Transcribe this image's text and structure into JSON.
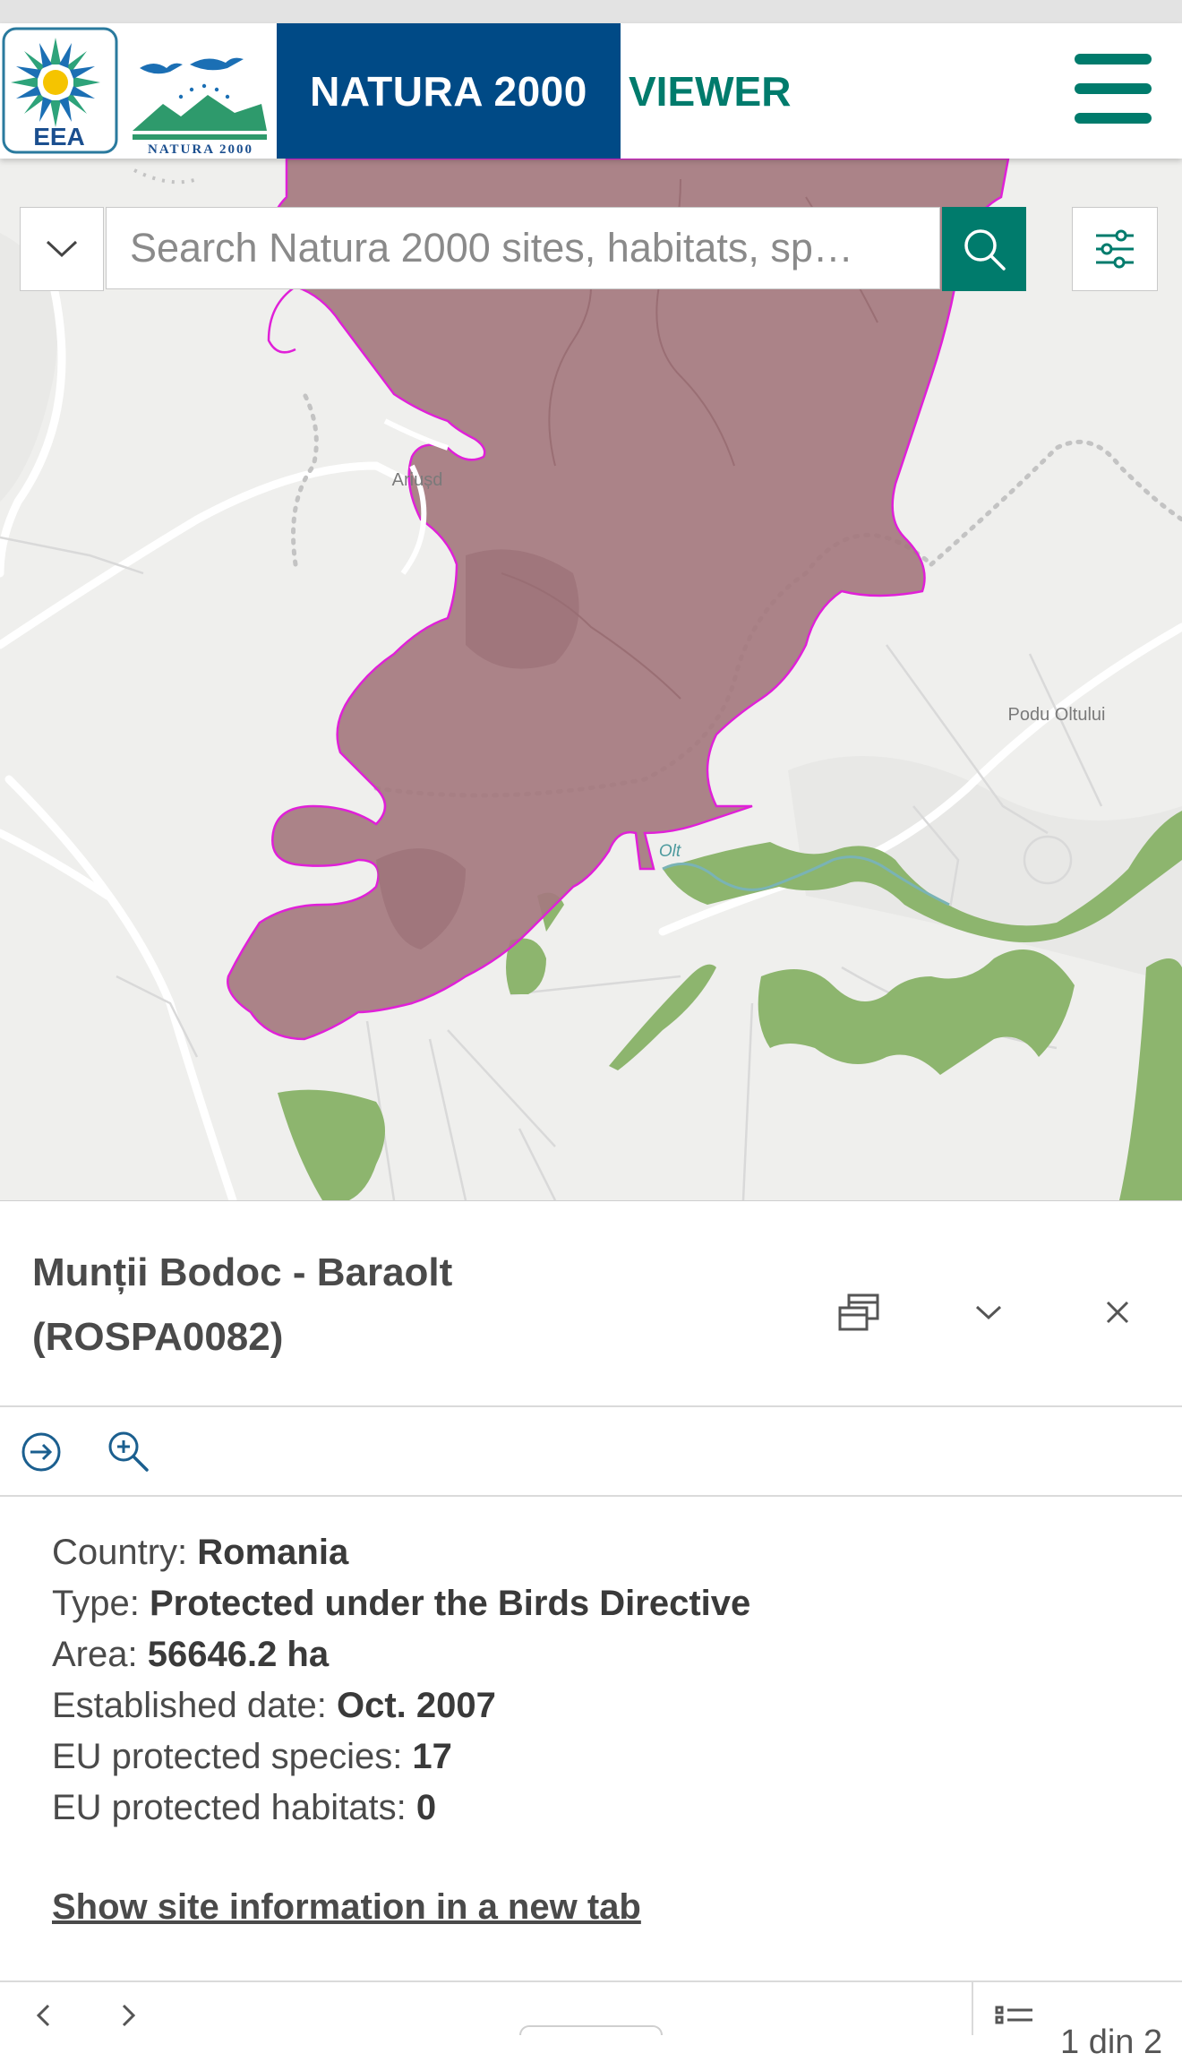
{
  "header": {
    "title": "NATURA 2000",
    "subtitle": "VIEWER",
    "eea_logo_text": "EEA",
    "natura_logo_text": "NATURA 2000"
  },
  "search": {
    "placeholder": "Search Natura 2000 sites, habitats, sp…"
  },
  "map": {
    "place_labels": [
      "Ariușd",
      "Podu Oltului",
      "Olt"
    ],
    "colors": {
      "site_fill": "#a5797f",
      "site_outline": "#e020d8",
      "green_areas": "#8db56e",
      "water": "#7ab3b5",
      "background": "#efefed"
    }
  },
  "popup": {
    "title_line1": "Munții Bodoc - Baraolt",
    "title_line2": "(ROSPA0082)",
    "fields": [
      {
        "label": "Country: ",
        "value": "Romania"
      },
      {
        "label": "Type: ",
        "value": "Protected under the Birds Directive"
      },
      {
        "label": "Area: ",
        "value": "56646.2 ha"
      },
      {
        "label": "Established date: ",
        "value": "Oct. 2007"
      },
      {
        "label": "EU protected species: ",
        "value": "17"
      },
      {
        "label": "EU protected habitats: ",
        "value": "0"
      }
    ],
    "link_text": "Show site information in a new tab",
    "pager": "1 din 2"
  },
  "icons": {
    "dropdown": "chevron-down-icon",
    "search": "search-icon",
    "filter": "filter-sliders-icon",
    "dock": "dock-icon",
    "collapse": "chevron-down-icon",
    "close": "close-icon",
    "navigate": "arrow-circle-right-icon",
    "zoom": "zoom-in-icon",
    "prev": "chevron-left-icon",
    "next": "chevron-right-icon",
    "list": "list-icon"
  },
  "colors": {
    "header_blue": "#004a86",
    "accent_green": "#007b6c"
  }
}
